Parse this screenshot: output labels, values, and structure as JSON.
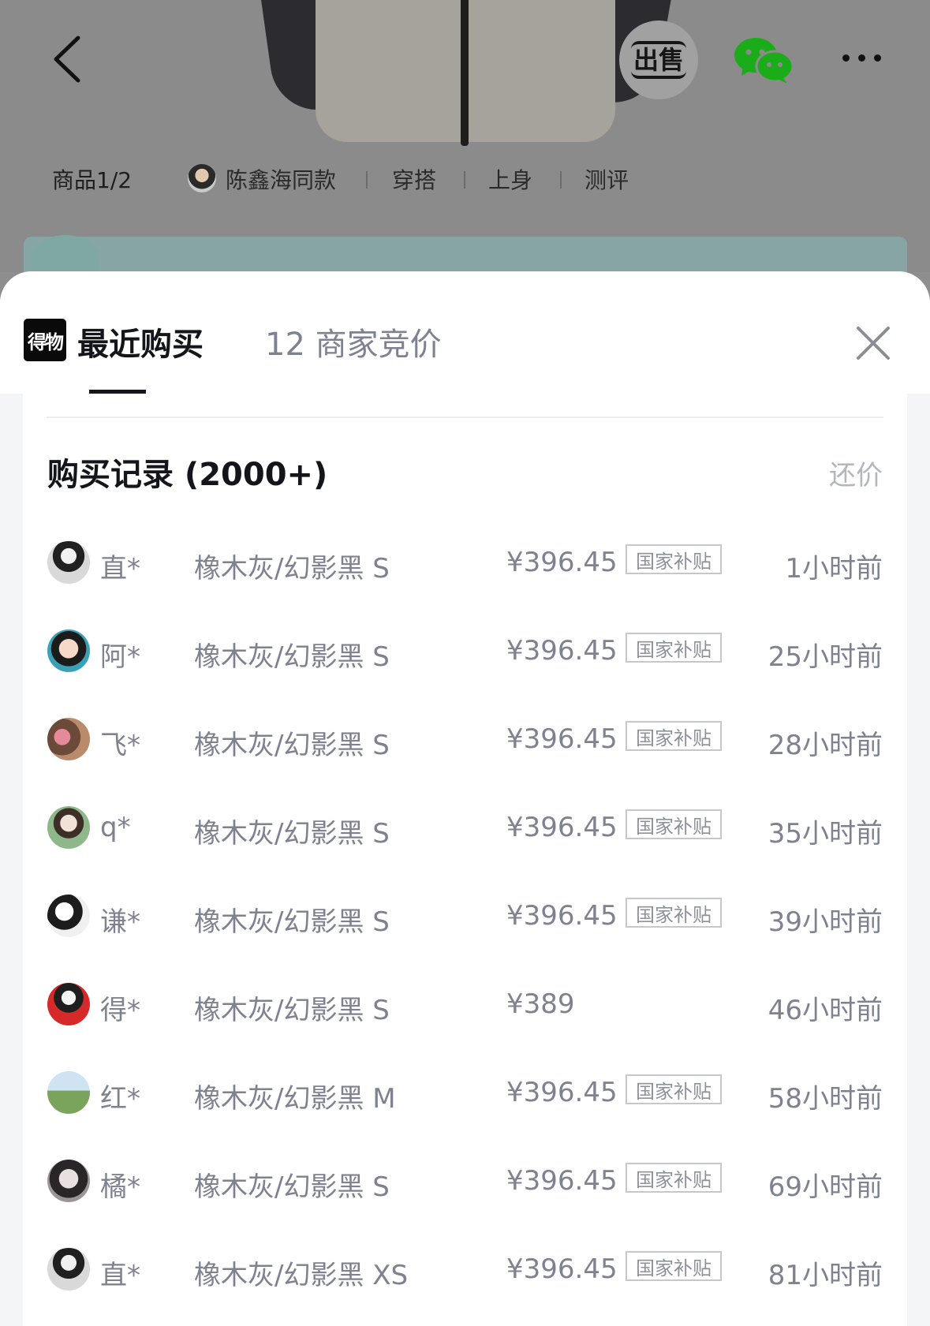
{
  "header": {
    "sell_label": "出售",
    "tabs": {
      "product": "商品1/2",
      "celebrity_style": "陈鑫海同款",
      "outfit": "穿搭",
      "on_body": "上身",
      "review": "测评"
    }
  },
  "sheet": {
    "brand_logo": "得物",
    "tab_recent": "最近购买",
    "tab_bid": "12 商家竞价",
    "section_title": "购买记录 (2000+)",
    "counter_offer": "还价",
    "rows": [
      {
        "buyer": "直*",
        "variant": "橡木灰/幻影黑 S",
        "price": "¥396.45",
        "badge": "国家补贴",
        "time": "1小时前"
      },
      {
        "buyer": "阿*",
        "variant": "橡木灰/幻影黑 S",
        "price": "¥396.45",
        "badge": "国家补贴",
        "time": "25小时前"
      },
      {
        "buyer": "飞*",
        "variant": "橡木灰/幻影黑 S",
        "price": "¥396.45",
        "badge": "国家补贴",
        "time": "28小时前"
      },
      {
        "buyer": "q*",
        "variant": "橡木灰/幻影黑 S",
        "price": "¥396.45",
        "badge": "国家补贴",
        "time": "35小时前"
      },
      {
        "buyer": "谦*",
        "variant": "橡木灰/幻影黑 S",
        "price": "¥396.45",
        "badge": "国家补贴",
        "time": "39小时前"
      },
      {
        "buyer": "得*",
        "variant": "橡木灰/幻影黑 S",
        "price": "¥389",
        "badge": "",
        "time": "46小时前"
      },
      {
        "buyer": "红*",
        "variant": "橡木灰/幻影黑 M",
        "price": "¥396.45",
        "badge": "国家补贴",
        "time": "58小时前"
      },
      {
        "buyer": "橘*",
        "variant": "橡木灰/幻影黑 S",
        "price": "¥396.45",
        "badge": "国家补贴",
        "time": "69小时前"
      },
      {
        "buyer": "直*",
        "variant": "橡木灰/幻影黑 XS",
        "price": "¥396.45",
        "badge": "国家补贴",
        "time": "81小时前"
      }
    ]
  },
  "colors": {
    "accent_wechat": "#1aad19",
    "text_primary": "#14151a",
    "text_secondary": "#7e8290",
    "badge_border": "#c5c7cc"
  }
}
